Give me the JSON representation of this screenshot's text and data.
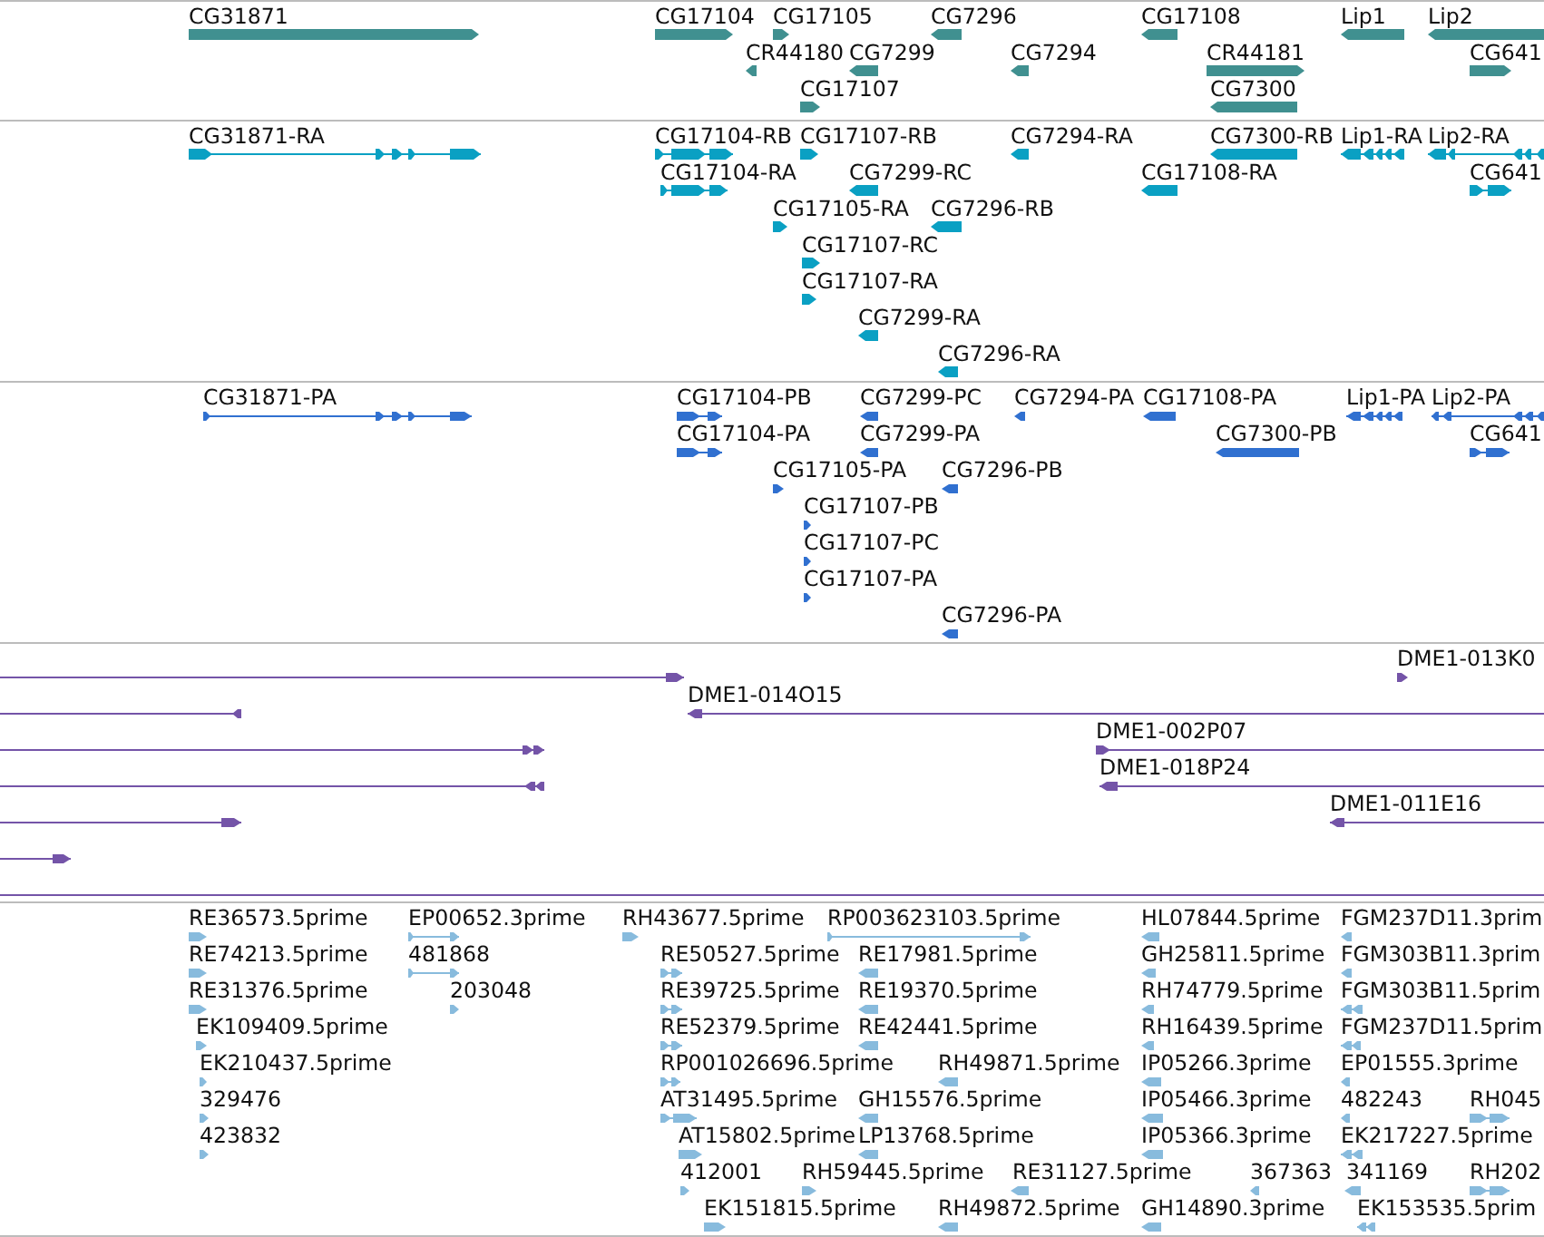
{
  "tracks": [
    {
      "kind": "gene",
      "features": [
        {
          "label": "CG31871",
          "reverse": false
        },
        {
          "label": "CG17104",
          "reverse": false
        },
        {
          "label": "CG17105",
          "reverse": false
        },
        {
          "label": "CG7296",
          "reverse": true
        },
        {
          "label": "CG17108",
          "reverse": true
        },
        {
          "label": "Lip1",
          "reverse": true
        },
        {
          "label": "Lip2",
          "reverse": true
        },
        {
          "label": "CR44180",
          "reverse": true
        },
        {
          "label": "CG7299",
          "reverse": true
        },
        {
          "label": "CG7294",
          "reverse": true
        },
        {
          "label": "CR44181",
          "reverse": false
        },
        {
          "label": "CG641",
          "reverse": false
        },
        {
          "label": "CG17107",
          "reverse": false
        },
        {
          "label": "CG7300",
          "reverse": true
        }
      ]
    },
    {
      "kind": "transcript",
      "features": [
        {
          "label": "CG31871-RA",
          "reverse": false
        },
        {
          "label": "CG17104-RB",
          "reverse": false
        },
        {
          "label": "CG17107-RB",
          "reverse": false
        },
        {
          "label": "CG7294-RA",
          "reverse": true
        },
        {
          "label": "CG7300-RB",
          "reverse": true
        },
        {
          "label": "Lip1-RA",
          "reverse": true
        },
        {
          "label": "Lip2-RA",
          "reverse": true
        },
        {
          "label": "CG17104-RA",
          "reverse": false
        },
        {
          "label": "CG7299-RC",
          "reverse": true
        },
        {
          "label": "CG17108-RA",
          "reverse": true
        },
        {
          "label": "CG641",
          "reverse": false
        },
        {
          "label": "CG17105-RA",
          "reverse": false
        },
        {
          "label": "CG7296-RB",
          "reverse": true
        },
        {
          "label": "CG17107-RC",
          "reverse": false
        },
        {
          "label": "CG17107-RA",
          "reverse": false
        },
        {
          "label": "CG7299-RA",
          "reverse": true
        },
        {
          "label": "CG7296-RA",
          "reverse": true
        }
      ]
    },
    {
      "kind": "protein",
      "features": [
        {
          "label": "CG31871-PA",
          "reverse": false
        },
        {
          "label": "CG17104-PB",
          "reverse": false
        },
        {
          "label": "CG7299-PC",
          "reverse": true
        },
        {
          "label": "CG7294-PA",
          "reverse": true
        },
        {
          "label": "CG17108-PA",
          "reverse": true
        },
        {
          "label": "Lip1-PA",
          "reverse": true
        },
        {
          "label": "Lip2-PA",
          "reverse": true
        },
        {
          "label": "CG17104-PA",
          "reverse": false
        },
        {
          "label": "CG7299-PA",
          "reverse": true
        },
        {
          "label": "CG7300-PB",
          "reverse": true
        },
        {
          "label": "CG641",
          "reverse": false
        },
        {
          "label": "CG17105-PA",
          "reverse": false
        },
        {
          "label": "CG7296-PB",
          "reverse": true
        },
        {
          "label": "CG17107-PB",
          "reverse": false
        },
        {
          "label": "CG17107-PC",
          "reverse": false
        },
        {
          "label": "CG17107-PA",
          "reverse": false
        },
        {
          "label": "CG7296-PA",
          "reverse": true
        }
      ]
    },
    {
      "kind": "clone",
      "features": [
        {
          "reverse": false
        },
        {
          "label": "DME1-013K0",
          "reverse": false
        },
        {
          "reverse": true
        },
        {
          "label": "DME1-014O15",
          "reverse": true
        },
        {
          "reverse": false
        },
        {
          "label": "DME1-002P07",
          "reverse": false
        },
        {
          "reverse": true
        },
        {
          "label": "DME1-018P24",
          "reverse": true
        },
        {
          "reverse": false
        },
        {
          "label": "DME1-011E16",
          "reverse": true
        },
        {
          "reverse": false
        }
      ]
    },
    {
      "kind": "est",
      "features": [
        {
          "label": "RE36573.5prime",
          "reverse": false
        },
        {
          "label": "EP00652.3prime",
          "reverse": false
        },
        {
          "label": "RH43677.5prime",
          "reverse": false
        },
        {
          "label": "RP003623103.5prime",
          "reverse": false
        },
        {
          "label": "HL07844.5prime",
          "reverse": true
        },
        {
          "label": "FGM237D11.3prim",
          "reverse": true
        },
        {
          "label": "RE74213.5prime",
          "reverse": false
        },
        {
          "label": "481868",
          "reverse": false
        },
        {
          "label": "RE50527.5prime",
          "reverse": false
        },
        {
          "label": "RE17981.5prime",
          "reverse": true
        },
        {
          "label": "GH25811.5prime",
          "reverse": true
        },
        {
          "label": "FGM303B11.3prim",
          "reverse": true
        },
        {
          "label": "RE31376.5prime",
          "reverse": false
        },
        {
          "label": "203048",
          "reverse": false
        },
        {
          "label": "RE39725.5prime",
          "reverse": false
        },
        {
          "label": "RE19370.5prime",
          "reverse": true
        },
        {
          "label": "RH74779.5prime",
          "reverse": true
        },
        {
          "label": "FGM303B11.5prim",
          "reverse": true
        },
        {
          "label": "EK109409.5prime",
          "reverse": false
        },
        {
          "label": "RE52379.5prime",
          "reverse": false
        },
        {
          "label": "RE42441.5prime",
          "reverse": true
        },
        {
          "label": "RH16439.5prime",
          "reverse": true
        },
        {
          "label": "FGM237D11.5prim",
          "reverse": true
        },
        {
          "label": "EK210437.5prime",
          "reverse": false
        },
        {
          "label": "RP001026696.5prime",
          "reverse": false
        },
        {
          "label": "RH49871.5prime",
          "reverse": true
        },
        {
          "label": "IP05266.3prime",
          "reverse": true
        },
        {
          "label": "EP01555.3prime",
          "reverse": true
        },
        {
          "label": "329476",
          "reverse": false
        },
        {
          "label": "AT31495.5prime",
          "reverse": false
        },
        {
          "label": "GH15576.5prime",
          "reverse": true
        },
        {
          "label": "IP05466.3prime",
          "reverse": true
        },
        {
          "label": "482243",
          "reverse": true
        },
        {
          "label": "RH045",
          "reverse": false
        },
        {
          "label": "423832",
          "reverse": false
        },
        {
          "label": "AT15802.5prime",
          "reverse": false
        },
        {
          "label": "LP13768.5prime",
          "reverse": true
        },
        {
          "label": "IP05366.3prime",
          "reverse": true
        },
        {
          "label": "EK217227.5prime",
          "reverse": true
        },
        {
          "label": "412001",
          "reverse": false
        },
        {
          "label": "RH59445.5prime",
          "reverse": false
        },
        {
          "label": "RE31127.5prime",
          "reverse": true
        },
        {
          "label": "367363",
          "reverse": true
        },
        {
          "label": "341169",
          "reverse": true
        },
        {
          "label": "RH202",
          "reverse": false
        },
        {
          "label": "EK151815.5prime",
          "reverse": false
        },
        {
          "label": "RH49872.5prime",
          "reverse": true
        },
        {
          "label": "GH14890.3prime",
          "reverse": true
        },
        {
          "label": "EK153535.5prim",
          "reverse": true
        }
      ]
    }
  ]
}
